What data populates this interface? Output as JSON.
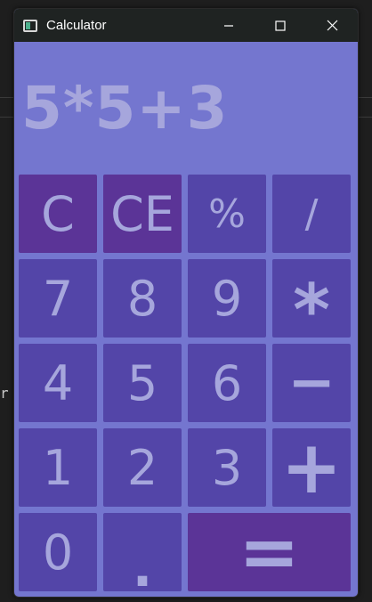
{
  "window": {
    "title": "Calculator",
    "controls": [
      "minimize-icon",
      "maximize-icon",
      "close-icon"
    ]
  },
  "display": {
    "expression": "5*5+3"
  },
  "keys": {
    "row1": [
      "C",
      "CE",
      "%",
      "/"
    ],
    "row2": [
      "7",
      "8",
      "9",
      "*"
    ],
    "row3": [
      "4",
      "5",
      "6",
      "−"
    ],
    "row4": [
      "1",
      "2",
      "3",
      "+"
    ],
    "row5": [
      "0",
      ".",
      "="
    ]
  },
  "background": {
    "code_fragment": "r"
  },
  "colors": {
    "window_bg": "#7476cf",
    "key_bg": "#5345a8",
    "function_key_bg": "#5b3497",
    "key_text": "#a6a6dc",
    "titlebar_bg": "#1f2322"
  }
}
